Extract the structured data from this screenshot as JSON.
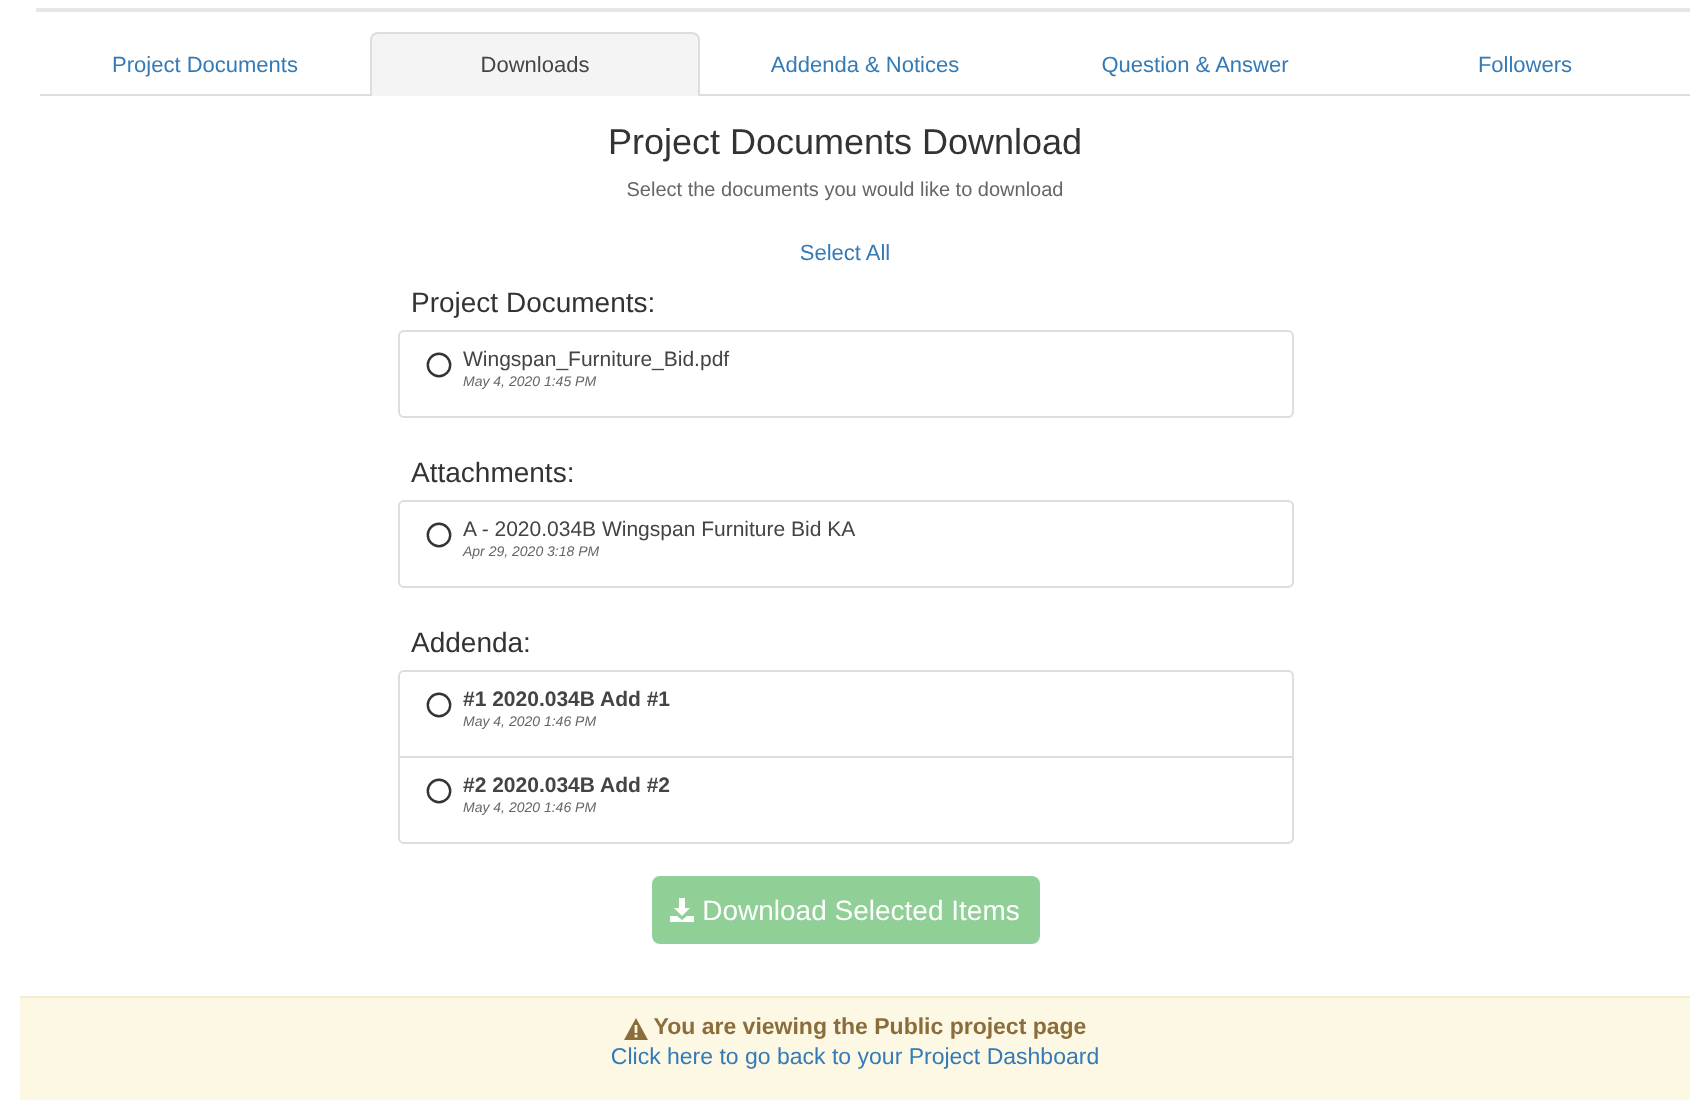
{
  "tabs": [
    {
      "label": "Project Documents",
      "selected": false
    },
    {
      "label": "Downloads",
      "selected": true
    },
    {
      "label": "Addenda & Notices",
      "selected": false
    },
    {
      "label": "Question & Answer",
      "selected": false
    },
    {
      "label": "Followers",
      "selected": false
    }
  ],
  "heading": "Project Documents Download",
  "subheading": "Select the documents you would like to download",
  "select_all": "Select All",
  "sections": [
    {
      "title": "Project Documents:",
      "items": [
        {
          "name": "Wingspan_Furniture_Bid.pdf",
          "date": "May 4, 2020 1:45 PM",
          "bold": false,
          "checked": false
        }
      ]
    },
    {
      "title": "Attachments:",
      "items": [
        {
          "name": "A - 2020.034B Wingspan Furniture Bid KA",
          "date": "Apr 29, 2020 3:18 PM",
          "bold": false,
          "checked": false
        }
      ]
    },
    {
      "title": "Addenda:",
      "items": [
        {
          "name": "#1 2020.034B Add #1",
          "date": "May 4, 2020 1:46 PM",
          "bold": true,
          "checked": false
        },
        {
          "name": "#2 2020.034B Add #2",
          "date": "May 4, 2020 1:46 PM",
          "bold": true,
          "checked": false
        }
      ]
    }
  ],
  "download_button": {
    "label": "Download Selected Items",
    "disabled": true
  },
  "notice": {
    "message": "You are viewing the Public project page",
    "link": "Click here to go back to your Project Dashboard"
  }
}
